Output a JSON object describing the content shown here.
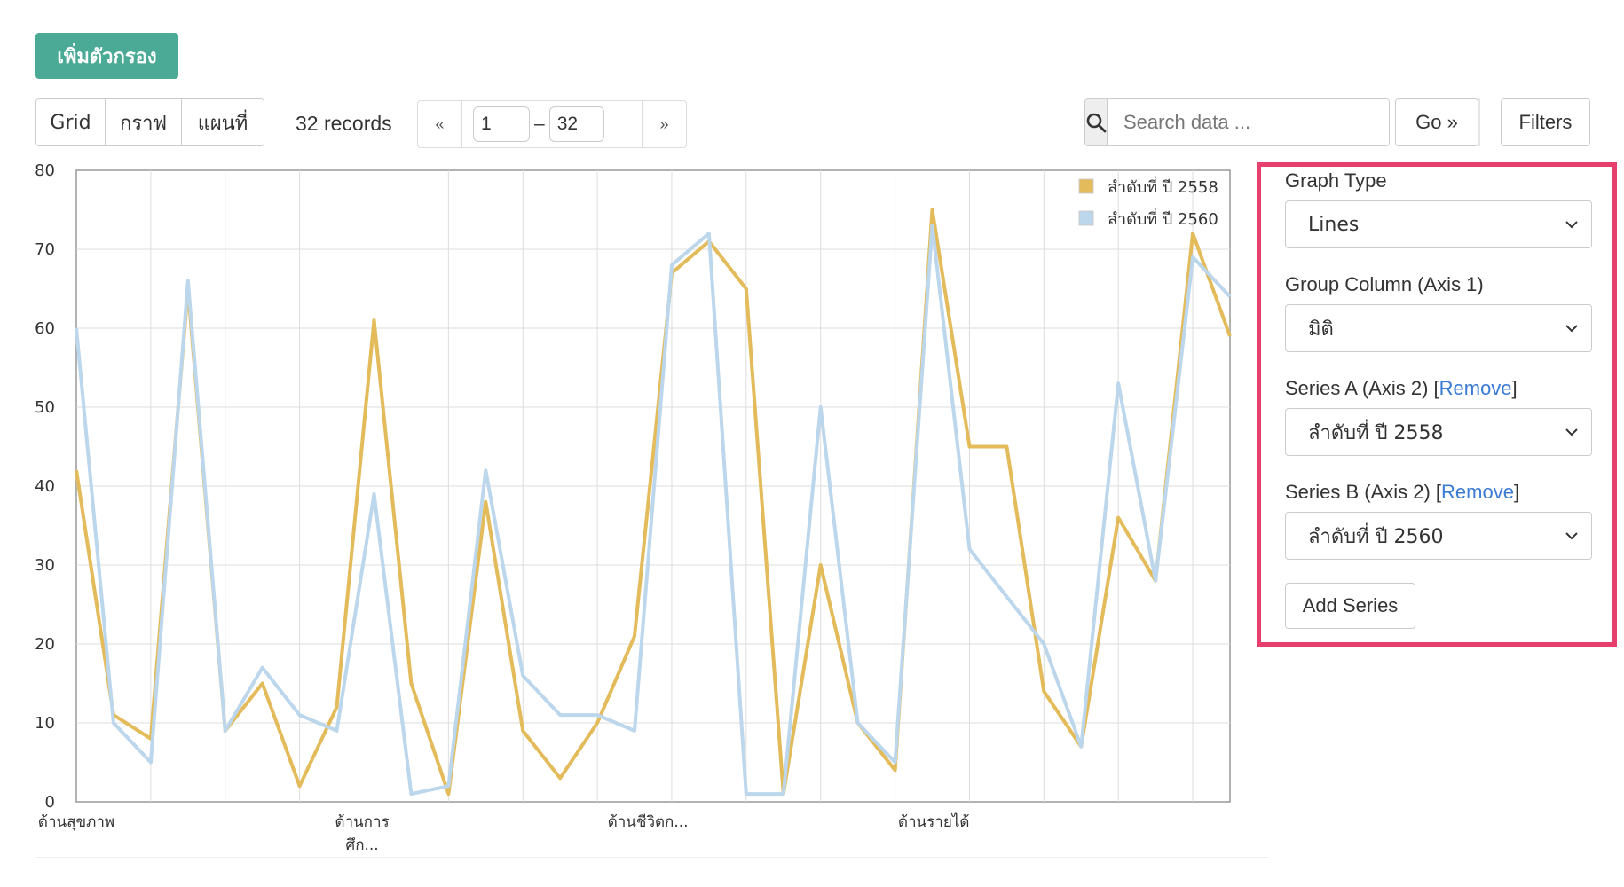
{
  "toolbar": {
    "add_filter_label": "เพิ่มตัวกรอง",
    "view_tabs": [
      "Grid",
      "กราฟ",
      "แผนที่"
    ],
    "records": "32 records",
    "pager": {
      "prev": "«",
      "from": "1",
      "to": "32",
      "next": "»",
      "dash": "–"
    },
    "search_placeholder": "Search data ...",
    "go_label": "Go »",
    "filters_label": "Filters"
  },
  "panel": {
    "graph_type_label": "Graph Type",
    "graph_type_value": "Lines",
    "group_column_label": "Group Column (Axis 1)",
    "group_column_value": "มิติ",
    "series_a_label": "Series A (Axis 2) [",
    "series_a_link": "Remove",
    "series_a_close": "]",
    "series_a_value": "ลำดับที่ ปี 2558",
    "series_b_label": "Series B (Axis 2) [",
    "series_b_link": "Remove",
    "series_b_close": "]",
    "series_b_value": "ลำดับที่ ปี 2560",
    "add_series_label": "Add Series"
  },
  "colors": {
    "accent": "#4aaa96",
    "highlight_border": "#e63e6d",
    "link": "#3a7bd5",
    "series_a": "#e3bb5a",
    "series_b": "#bcd6ec"
  },
  "chart_data": {
    "type": "line",
    "ylim": [
      0,
      80
    ],
    "yticks": [
      0,
      10,
      20,
      30,
      40,
      50,
      60,
      70,
      80
    ],
    "xlabels": [
      {
        "index": 0,
        "lines": [
          "ด้านสุขภาพ"
        ]
      },
      {
        "index": 4,
        "lines": [
          "ด้านการ",
          "ศึก..."
        ]
      },
      {
        "index": 8,
        "lines": [
          "ด้านชีวิตก..."
        ]
      },
      {
        "index": 12,
        "lines": [
          "ด้านรายได้"
        ]
      }
    ],
    "grid": true,
    "legend_position": "top-right",
    "series": [
      {
        "name": "ลำดับที่ ปี 2558",
        "values": [
          42,
          11,
          8,
          65,
          9,
          15,
          2,
          12,
          61,
          15,
          1,
          38,
          9,
          3,
          10,
          21,
          67,
          71,
          65,
          1,
          30,
          10,
          4,
          75,
          45,
          45,
          14,
          7,
          36,
          28,
          72,
          59
        ]
      },
      {
        "name": "ลำดับที่ ปี 2560",
        "values": [
          60,
          10,
          5,
          66,
          9,
          17,
          11,
          9,
          39,
          1,
          2,
          42,
          16,
          11,
          11,
          9,
          68,
          72,
          1,
          1,
          50,
          10,
          5,
          73,
          32,
          26,
          20,
          7,
          53,
          28,
          69,
          64
        ]
      }
    ]
  }
}
